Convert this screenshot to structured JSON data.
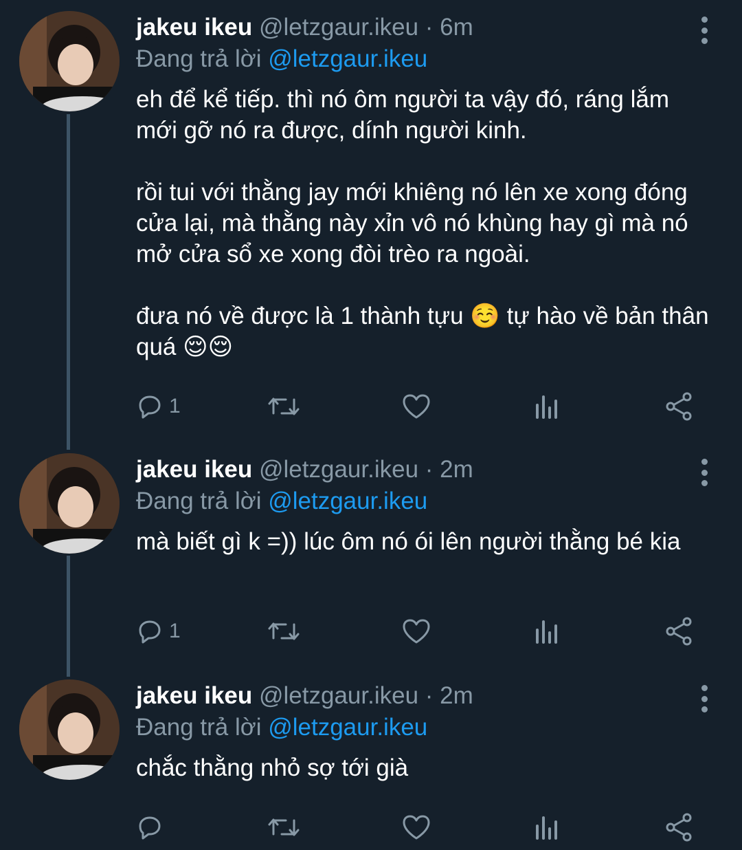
{
  "tweets": [
    {
      "name": "jakeu ikeu",
      "handle": "@letzgaur.ikeu",
      "separator": "·",
      "time": "6m",
      "reply_prefix": "Đang trả lời",
      "reply_to": "@letzgaur.ikeu",
      "text": "eh để kể tiếp. thì nó ôm người ta vậy đó, ráng lắm mới gỡ nó ra được, dính người kinh.\n\nrồi tui với thằng jay mới khiêng nó lên xe xong đóng cửa lại, mà thằng này xỉn vô nó khùng hay gì mà nó mở cửa sổ xe xong đòi trèo ra ngoài.\n\nđưa nó về được là 1 thành tựu ☺️ tự hào về bản thân quá 😌😌",
      "reply_count": "1"
    },
    {
      "name": "jakeu ikeu",
      "handle": "@letzgaur.ikeu",
      "separator": "·",
      "time": "2m",
      "reply_prefix": "Đang trả lời",
      "reply_to": "@letzgaur.ikeu",
      "text": "mà biết gì k =)) lúc ôm nó ói lên người thằng bé kia",
      "reply_count": "1"
    },
    {
      "name": "jakeu ikeu",
      "handle": "@letzgaur.ikeu",
      "separator": "·",
      "time": "2m",
      "reply_prefix": "Đang trả lời",
      "reply_to": "@letzgaur.ikeu",
      "text": "chắc thằng nhỏ sợ tới già",
      "reply_count": ""
    }
  ],
  "icons": {
    "reply": "reply-icon",
    "retweet": "retweet-icon",
    "like": "heart-icon",
    "analytics": "analytics-icon",
    "share": "share-icon",
    "more": "more-options-icon"
  },
  "colors": {
    "background": "#15202b",
    "muted": "#8899a6",
    "link": "#1d9bf0",
    "thread_line": "#3d5466"
  }
}
